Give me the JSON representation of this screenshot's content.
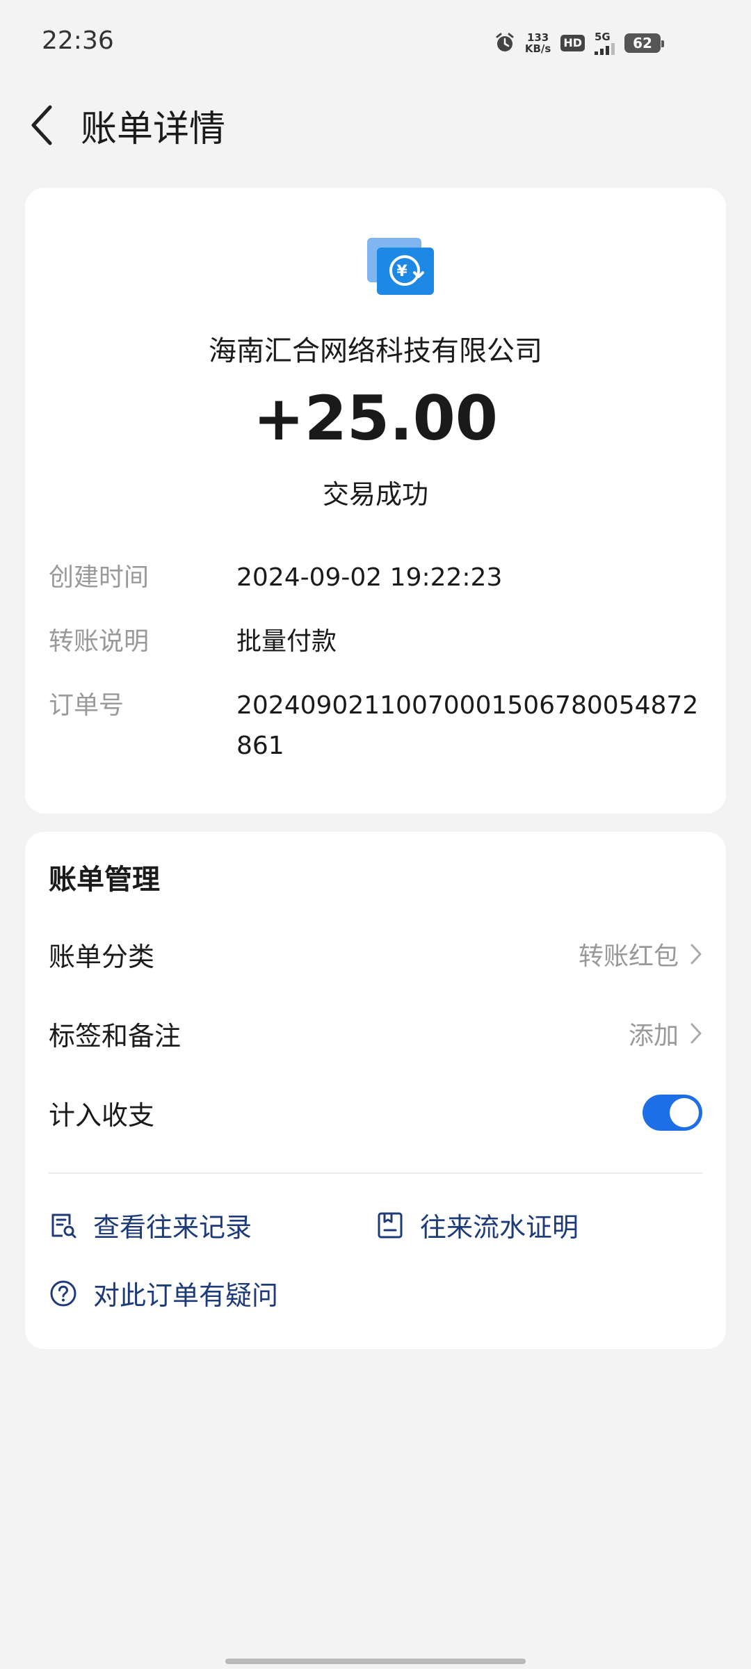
{
  "status_bar": {
    "time": "22:36",
    "net_speed_value": "133",
    "net_speed_unit": "KB/s",
    "hd": "HD",
    "network": "5G",
    "battery": "62"
  },
  "header": {
    "title": "账单详情",
    "back_icon": "chevron-left-icon"
  },
  "transaction": {
    "icon": "transfer-yuan-icon",
    "merchant": "海南汇合网络科技有限公司",
    "amount": "+25.00",
    "status": "交易成功",
    "details": [
      {
        "label": "创建时间",
        "value": "2024-09-02 19:22:23"
      },
      {
        "label": "转账说明",
        "value": "批量付款"
      },
      {
        "label": "订单号",
        "value": "20240902110070001506780054872861"
      }
    ]
  },
  "manage": {
    "title": "账单管理",
    "category_label": "账单分类",
    "category_value": "转账红包",
    "tag_label": "标签和备注",
    "tag_value": "添加",
    "count_label": "计入收支",
    "count_enabled": true,
    "links": {
      "history": "查看往来记录",
      "proof": "往来流水证明",
      "question": "对此订单有疑问"
    }
  },
  "colors": {
    "accent": "#1e6fe6",
    "link": "#1d3a7a",
    "secondary_text": "#999999",
    "background": "#f3f3f3"
  }
}
